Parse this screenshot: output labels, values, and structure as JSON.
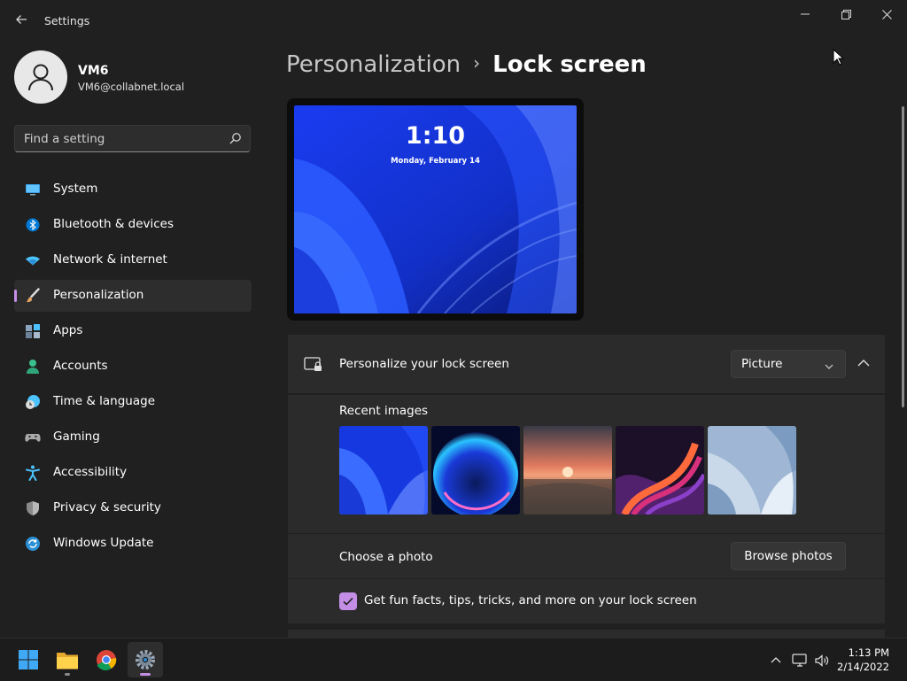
{
  "window": {
    "title": "Settings",
    "back_icon": "back-arrow-icon",
    "controls": [
      "minimize-icon",
      "restore-icon",
      "close-icon"
    ]
  },
  "profile": {
    "name": "VM6",
    "email": "VM6@collabnet.local"
  },
  "search": {
    "placeholder": "Find a setting",
    "icon": "search-icon"
  },
  "nav": {
    "items": [
      {
        "label": "System",
        "icon": "monitor-icon",
        "color": "#4cc2ff"
      },
      {
        "label": "Bluetooth & devices",
        "icon": "bluetooth-icon",
        "color": "#0078d4"
      },
      {
        "label": "Network & internet",
        "icon": "wifi-icon",
        "color": "#4cc2ff"
      },
      {
        "label": "Personalization",
        "icon": "paintbrush-icon",
        "color": "#e8a765",
        "active": true
      },
      {
        "label": "Apps",
        "icon": "apps-icon",
        "color": "#9bb1c8"
      },
      {
        "label": "Accounts",
        "icon": "person-icon",
        "color": "#3ac28c"
      },
      {
        "label": "Time & language",
        "icon": "clock-globe-icon",
        "color": "#4cc2ff"
      },
      {
        "label": "Gaming",
        "icon": "gamepad-icon",
        "color": "#b0b0b0"
      },
      {
        "label": "Accessibility",
        "icon": "accessibility-icon",
        "color": "#4cc2ff"
      },
      {
        "label": "Privacy & security",
        "icon": "shield-icon",
        "color": "#9a9a9a"
      },
      {
        "label": "Windows Update",
        "icon": "update-icon",
        "color": "#4cc2ff"
      }
    ]
  },
  "breadcrumb": {
    "parent": "Personalization",
    "separator": "›",
    "current": "Lock screen"
  },
  "preview": {
    "time": "1:10",
    "date": "Monday, February 14"
  },
  "lock_screen": {
    "label": "Personalize your lock screen",
    "icon": "lock-screen-icon",
    "dropdown_value": "Picture",
    "recent_images_label": "Recent images",
    "recent_images": [
      "bloom-blue",
      "glow-orb",
      "sunset-lake",
      "swirl-ribbon",
      "bloom-light"
    ],
    "choose_photo_label": "Choose a photo",
    "browse_button": "Browse photos",
    "fun_facts_label": "Get fun facts, tips, tricks, and more on your lock screen",
    "fun_facts_checked": true
  },
  "taskbar": {
    "apps": [
      "windows-start-icon",
      "file-explorer-icon",
      "chrome-icon",
      "settings-gear-icon"
    ],
    "active_app": "settings-gear-icon",
    "tray_icons": [
      "chevron-up-icon",
      "network-icon",
      "volume-icon"
    ],
    "time": "1:13 PM",
    "date": "2/14/2022"
  },
  "colors": {
    "accent": "#c48ee6",
    "background": "#202020",
    "card": "#2b2b2b"
  }
}
